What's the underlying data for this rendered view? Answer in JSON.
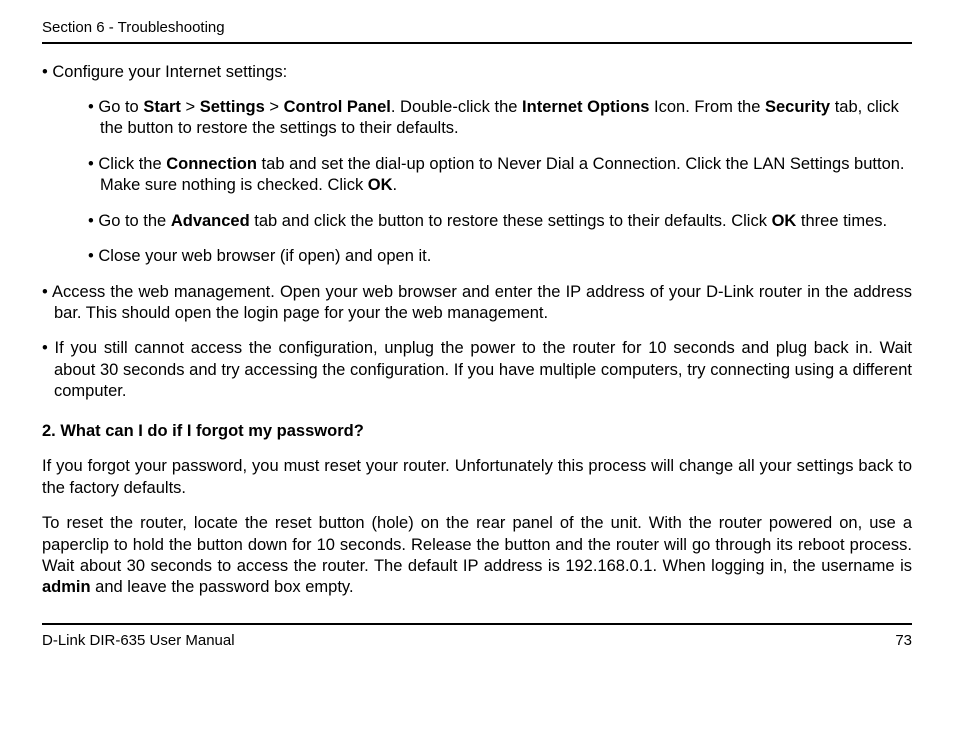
{
  "header": "Section 6 - Troubleshooting",
  "main_bullet1": "• Configure your Internet settings:",
  "sub1_pre": "• Go to ",
  "sub1_b1": "Start",
  "sub1_gt1": " > ",
  "sub1_b2": "Settings",
  "sub1_gt2": " > ",
  "sub1_b3": "Control Panel",
  "sub1_mid1": ". Double-click the ",
  "sub1_b4": "Internet Options",
  "sub1_mid2": " Icon. From the ",
  "sub1_b5": "Security",
  "sub1_post": " tab, click the button to restore the settings to their defaults.",
  "sub2_pre": "• Click the ",
  "sub2_b1": "Connection",
  "sub2_mid": " tab and set the dial-up option to Never Dial a Connection. Click the LAN Settings button. Make sure nothing is checked. Click ",
  "sub2_b2": "OK",
  "sub2_post": ".",
  "sub3_pre": "• Go to the ",
  "sub3_b1": "Advanced",
  "sub3_mid": " tab and click the button to restore these settings to their defaults. Click ",
  "sub3_b2": "OK",
  "sub3_post": " three times.",
  "sub4": "• Close your web browser (if open) and open it.",
  "main_bullet2": "• Access the web management. Open your web browser and enter the IP address of your D-Link router in the address bar. This should open the login page for your the web management.",
  "main_bullet3": "• If you still cannot access the configuration, unplug the power to the router for 10 seconds and plug back in. Wait about 30 seconds and try accessing the configuration. If you have multiple computers, try connecting using a different computer.",
  "q2": "2. What can I do if I forgot my password?",
  "p1": "If you forgot your password, you must reset your router. Unfortunately this process will change all your settings back to the factory defaults.",
  "p2_pre": "To reset the router, locate the reset button (hole) on the rear panel of the unit. With the router powered on, use a paperclip to hold the button down for 10 seconds. Release the button and the router will go through its reboot process. Wait about 30 seconds to access the router. The default IP address is 192.168.0.1. When logging in, the username is ",
  "p2_b": "admin",
  "p2_post": " and leave the password box empty.",
  "footer_left": "D-Link DIR-635 User Manual",
  "footer_right": "73"
}
